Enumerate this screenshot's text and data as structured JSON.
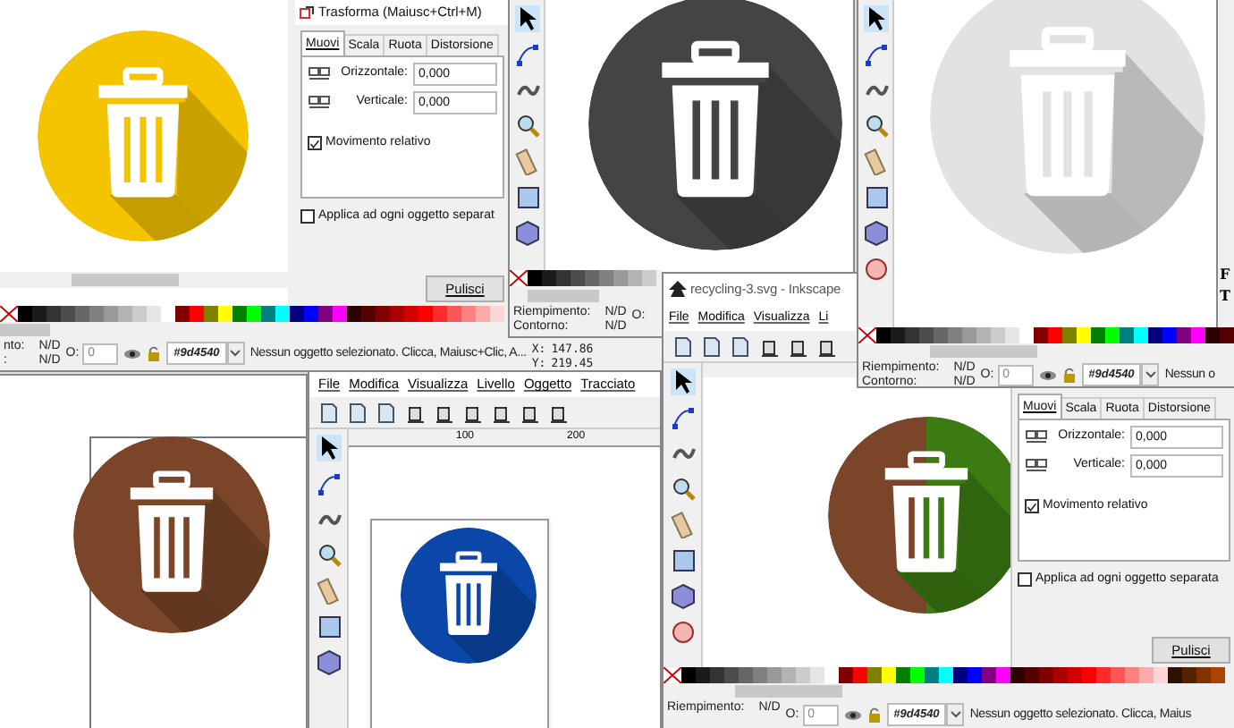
{
  "palette": [
    {
      "color": "#000000"
    },
    {
      "color": "#1a1a1a"
    },
    {
      "color": "#333333"
    },
    {
      "color": "#4d4d4d"
    },
    {
      "color": "#666666"
    },
    {
      "color": "#808080"
    },
    {
      "color": "#999999"
    },
    {
      "color": "#b3b3b3"
    },
    {
      "color": "#cccccc"
    },
    {
      "color": "#e6e6e6"
    },
    {
      "color": "#ffffff"
    },
    {
      "color": "#800000"
    },
    {
      "color": "#ff0000"
    },
    {
      "color": "#808000"
    },
    {
      "color": "#ffff00"
    },
    {
      "color": "#008000"
    },
    {
      "color": "#00ff00"
    },
    {
      "color": "#008080"
    },
    {
      "color": "#00ffff"
    },
    {
      "color": "#000080"
    },
    {
      "color": "#0000ff"
    },
    {
      "color": "#800080"
    },
    {
      "color": "#ff00ff"
    },
    {
      "color": "#2b0000"
    },
    {
      "color": "#550000"
    },
    {
      "color": "#800000"
    },
    {
      "color": "#aa0000"
    },
    {
      "color": "#d40000"
    },
    {
      "color": "#ff0000"
    },
    {
      "color": "#ff2a2a"
    },
    {
      "color": "#ff5555"
    },
    {
      "color": "#ff8080"
    },
    {
      "color": "#ffaaaa"
    },
    {
      "color": "#ffd5d5"
    },
    {
      "color": "#2b1100"
    },
    {
      "color": "#552200"
    },
    {
      "color": "#803300"
    },
    {
      "color": "#aa4400"
    }
  ],
  "window_top_left": {
    "artwork": {
      "color": "#f5c400"
    },
    "dialog": {
      "title": "Trasforma (Maiusc+Ctrl+M)",
      "tabs": [
        {
          "label": "Muovi",
          "selected": true
        },
        {
          "label": "Scala",
          "selected": false
        },
        {
          "label": "Ruota",
          "selected": false
        },
        {
          "label": "Distorsione",
          "selected": false
        }
      ],
      "fields": [
        {
          "label": "Orizzontale:",
          "value": "0,000"
        },
        {
          "label": "Verticale:",
          "value": "0,000"
        }
      ],
      "checkboxes": [
        {
          "label": "Movimento relativo",
          "checked": true
        },
        {
          "label": "Applica ad ogni oggetto separat",
          "checked": false
        }
      ],
      "button": "Pulisci"
    },
    "status": {
      "fill_label": "nto:",
      "fill_value": "N/D",
      "stroke_label": ":",
      "stroke_value": "N/D",
      "opacity_label": "O:",
      "opacity_value": "0",
      "style_value": "#9d4540",
      "message": "Nessun oggetto selezionato. Clicca, Maiusc+Clic, A...",
      "x_label": "X:",
      "x_value": "147.86",
      "y_label": "Y:",
      "y_value": "219.45"
    }
  },
  "window_top_middle": {
    "artwork": {
      "color": "#444444"
    },
    "status": {
      "fill_label": "Riempimento:",
      "fill_value": "N/D",
      "stroke_label": "Contorno:",
      "stroke_value": "N/D",
      "opacity_label": "O:"
    }
  },
  "window_bottom_left": {
    "artwork": {
      "color": "#7a4528"
    }
  },
  "window_bottom_middle": {
    "menu": [
      "File",
      "Modifica",
      "Visualizza",
      "Livello",
      "Oggetto",
      "Tracciato"
    ],
    "ruler": [
      "100",
      "200"
    ],
    "artwork": {
      "color": "#0a47a8"
    }
  },
  "window_bottom_right": {
    "title": "recycling-3.svg - Inkscape",
    "menu": [
      "File",
      "Modifica",
      "Visualizza",
      "Li"
    ],
    "artwork": {
      "color": "#7a4528",
      "accent": {
        "color": "#3c7a12"
      }
    },
    "dialog": {
      "tabs": [
        {
          "label": "Muovi",
          "selected": true
        },
        {
          "label": "Scala",
          "selected": false
        },
        {
          "label": "Ruota",
          "selected": false
        },
        {
          "label": "Distorsione",
          "selected": false
        }
      ],
      "fields": [
        {
          "label": "Orizzontale:",
          "value": "0,000"
        },
        {
          "label": "Verticale:",
          "value": "0,000"
        }
      ],
      "checkboxes": [
        {
          "label": "Movimento relativo",
          "checked": true
        },
        {
          "label": "Applica ad ogni oggetto separata",
          "checked": false
        }
      ],
      "button": "Pulisci"
    },
    "status": {
      "fill_label": "Riempimento:",
      "fill_value": "N/D",
      "opacity_label": "O:",
      "opacity_value": "0",
      "style_value": "#9d4540",
      "message": "Nessun oggetto selezionato. Clicca, Maius"
    }
  },
  "window_top_right": {
    "artwork": {
      "color": "#e2e2e2"
    },
    "side_buttons": [
      "F",
      "T"
    ],
    "status": {
      "fill_label": "Riempimento:",
      "fill_value": "N/D",
      "stroke_label": "Contorno:",
      "stroke_value": "N/D",
      "opacity_label": "O:",
      "opacity_value": "0",
      "style_value": "#9d4540",
      "message": "Nessun o"
    }
  }
}
